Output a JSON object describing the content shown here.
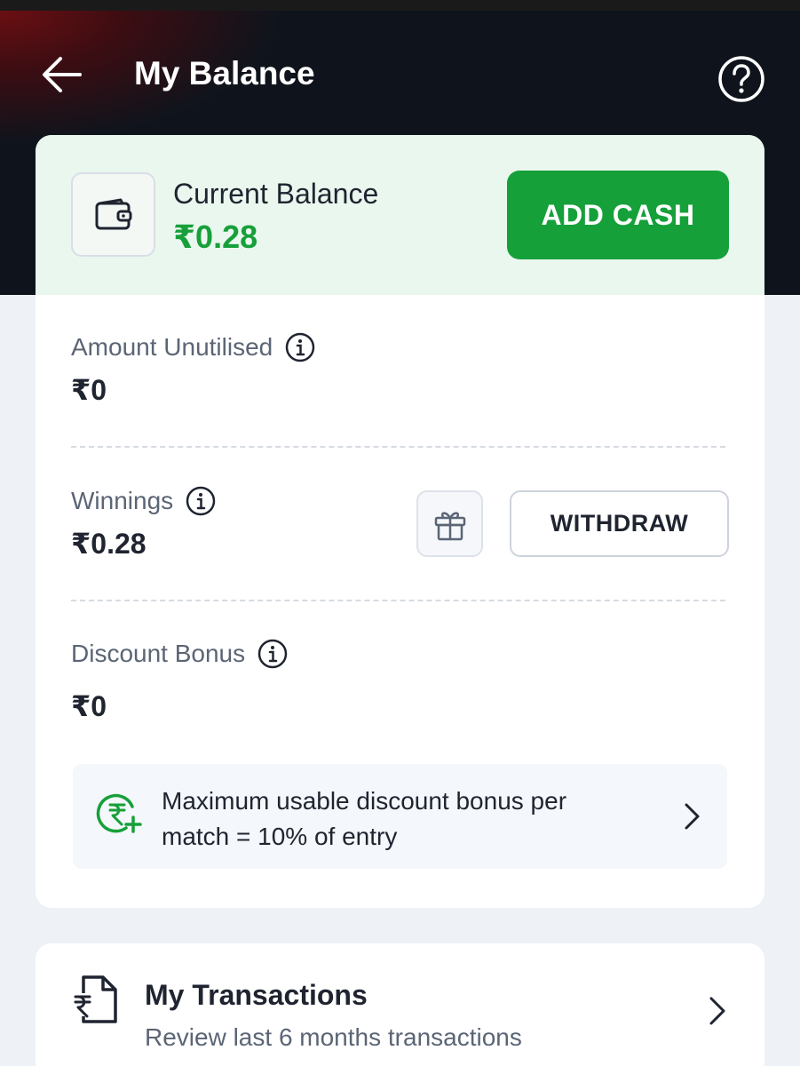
{
  "header": {
    "title": "My Balance",
    "back_icon": "arrow-left-icon",
    "help_icon": "question-circle-icon"
  },
  "current_balance": {
    "label": "Current Balance",
    "value": "₹0.28",
    "icon": "wallet-icon",
    "add_cash_label": "ADD CASH"
  },
  "amount_unutilised": {
    "label": "Amount Unutilised",
    "value": "₹0"
  },
  "winnings": {
    "label": "Winnings",
    "value": "₹0.28",
    "gift_icon": "gift-icon",
    "withdraw_label": "WITHDRAW"
  },
  "discount_bonus": {
    "label": "Discount Bonus",
    "value": "₹0",
    "info_text": "Maximum usable discount bonus per match = 10% of entry",
    "info_icon": "rupee-plus-icon"
  },
  "transactions": {
    "title": "My Transactions",
    "subtitle": "Review last 6 months transactions",
    "icon": "rupee-document-icon"
  },
  "colors": {
    "header_bg": "#0f141c",
    "accent_green": "#16a03a",
    "balance_bg": "#eaf7ee",
    "page_bg": "#eef1f6"
  }
}
